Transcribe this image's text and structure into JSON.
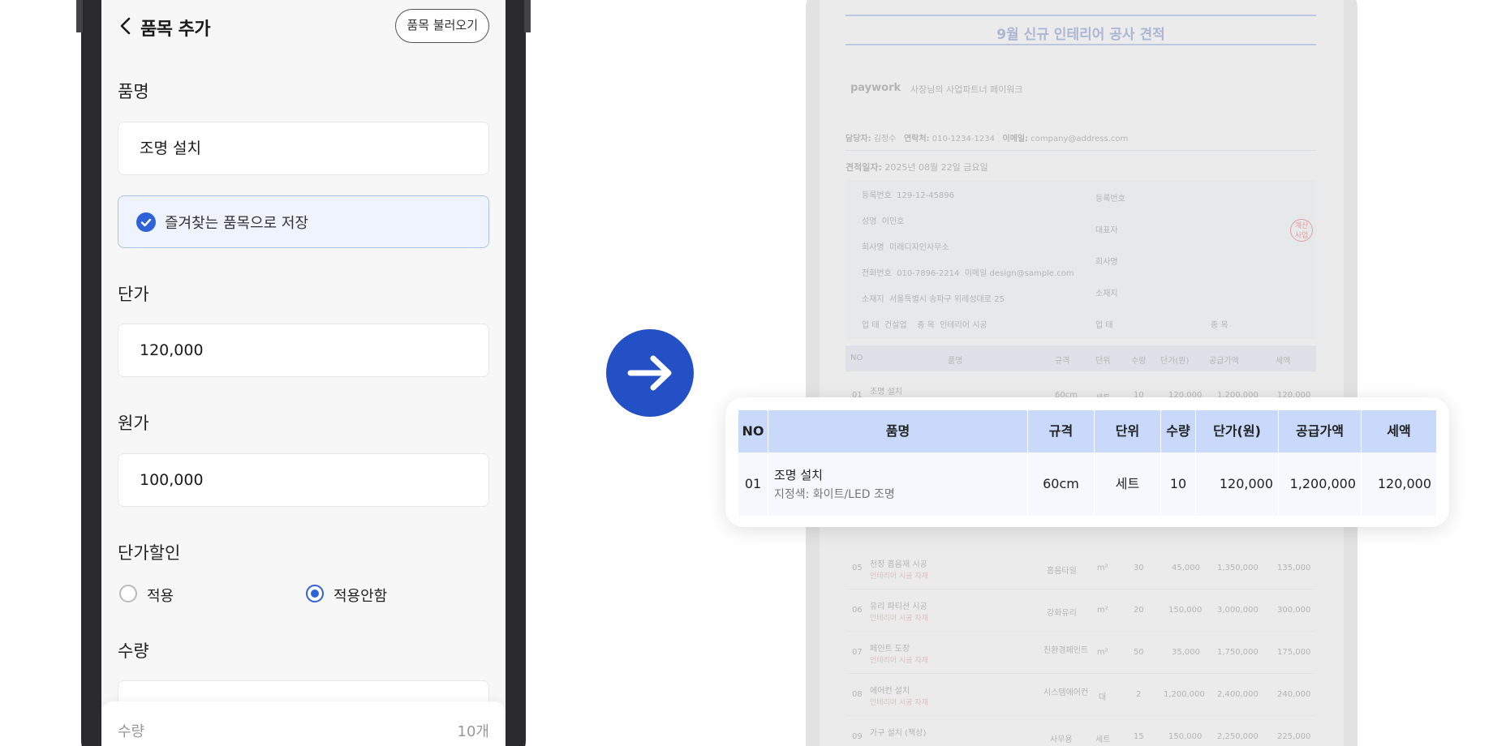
{
  "phone": {
    "header": {
      "title": "품목 추가",
      "load_button": "품목 불러오기"
    },
    "name_field": {
      "label": "품명",
      "value": "조명 설치"
    },
    "favorite": {
      "label": "즐겨찾는 품목으로 저장",
      "checked": true
    },
    "unit_price_field": {
      "label": "단가",
      "value": "120,000"
    },
    "cost_field": {
      "label": "원가",
      "value": "100,000"
    },
    "discount": {
      "label": "단가할인",
      "options": [
        "적용",
        "적용안함"
      ],
      "selected": "적용안함"
    },
    "quantity_label": "수량",
    "bottom_sheet": {
      "label": "수량",
      "value": "10개"
    }
  },
  "arrow": {
    "icon": "arrow-right-icon",
    "color": "#2350c4"
  },
  "document": {
    "title": "9월 신규 인테리어 공사 견적",
    "logo": "paywork",
    "slogan": "사장님의 사업파트너 페이워크",
    "contact": {
      "manager_label": "담당자:",
      "manager": "김정수",
      "phone_label": "연락처:",
      "phone": "010-1234-1234",
      "email_label": "이메일:",
      "email": "company@address.com"
    },
    "date_label": "견적일자:",
    "date": "2025년 08월 22일 금요일",
    "supplier": {
      "reg_label": "등록번호",
      "reg": "129-12-45896",
      "name_label": "성명",
      "name": "이민호",
      "company_label": "회사명",
      "company": "미래디자인사무소",
      "tel_label": "전화번호",
      "tel": "010-7896-2214",
      "email_label": "이메일",
      "email": "design@sample.com",
      "address_label": "소재지",
      "address": "서울특별시 송파구 위례성대로 25",
      "biz_type_label": "업 태",
      "biz_type": "건설업",
      "biz_item_label": "종 목",
      "biz_item": "인테리어 시공"
    },
    "receiver": {
      "reg_label": "등록번호",
      "rep_label": "대표자",
      "company_label": "회사명",
      "address_label": "소재지",
      "biz_type_label": "업 태",
      "biz_item_label": "종 목"
    },
    "stamp": "계산 사업",
    "table_headers": [
      "NO",
      "품명",
      "규격",
      "단위",
      "수량",
      "단가(원)",
      "공급가액",
      "세액"
    ],
    "rows": [
      {
        "no": "01",
        "name": "조명 설치",
        "sub": "",
        "spec": "60cm",
        "unit": "세트",
        "qty": "10",
        "price": "120,000",
        "supply": "1,200,000",
        "tax": "120,000"
      },
      {
        "no": "05",
        "name": "천장 흡음재 시공",
        "sub": "인테리어 시공 자재",
        "spec": "흡음타일",
        "unit": "m²",
        "qty": "30",
        "price": "45,000",
        "supply": "1,350,000",
        "tax": "135,000"
      },
      {
        "no": "06",
        "name": "유리 파티션 시공",
        "sub": "인테리어 시공 자재",
        "spec": "강화유리",
        "unit": "m²",
        "qty": "20",
        "price": "150,000",
        "supply": "3,000,000",
        "tax": "300,000"
      },
      {
        "no": "07",
        "name": "페인트 도장",
        "sub": "인테리어 시공 자재",
        "spec": "친환경페인트",
        "unit": "m²",
        "qty": "50",
        "price": "35,000",
        "supply": "1,750,000",
        "tax": "175,000"
      },
      {
        "no": "08",
        "name": "에어컨 설치",
        "sub": "인테리어 시공 자재",
        "spec": "시스템에어컨",
        "unit": "대",
        "qty": "2",
        "price": "1,200,000",
        "supply": "2,400,000",
        "tax": "240,000"
      },
      {
        "no": "09",
        "name": "가구 설치 (책상)",
        "sub": "",
        "spec": "사무용",
        "unit": "세트",
        "qty": "15",
        "price": "150,000",
        "supply": "2,250,000",
        "tax": "225,000"
      }
    ]
  },
  "card": {
    "headers": [
      "NO",
      "품명",
      "규격",
      "단위",
      "수량",
      "단가(원)",
      "공급가액",
      "세액"
    ],
    "row": {
      "no": "01",
      "name": "조명 설치",
      "spec_note": "지정색: 화이트/LED 조명",
      "spec": "60cm",
      "unit": "세트",
      "qty": "10",
      "price": "120,000",
      "supply": "1,200,000",
      "tax": "120,000"
    }
  }
}
